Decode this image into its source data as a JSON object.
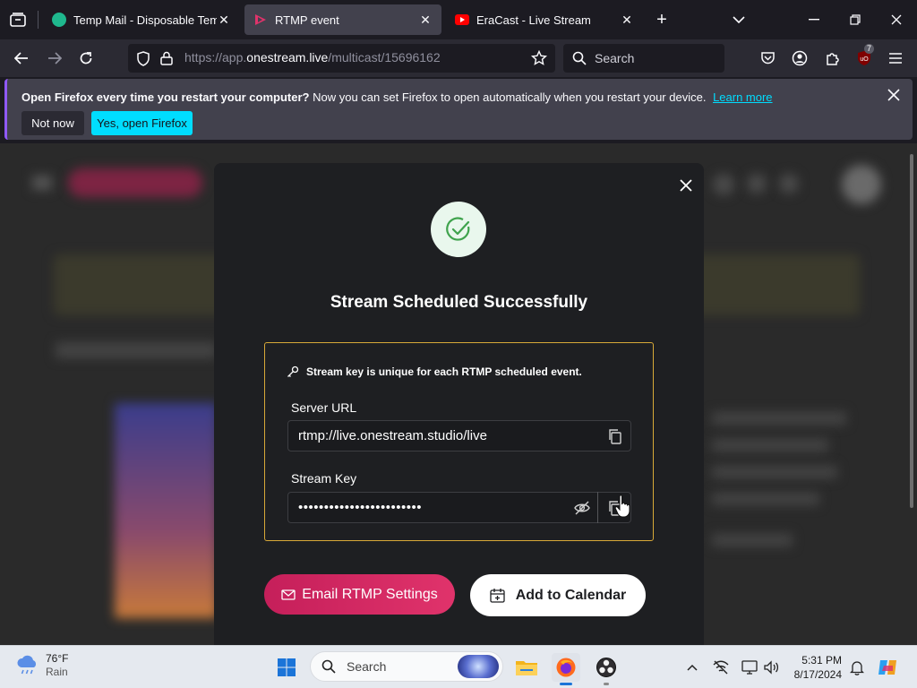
{
  "tabs": [
    {
      "title": "Temp Mail - Disposable Tempo",
      "active": false
    },
    {
      "title": "RTMP event",
      "active": true
    },
    {
      "title": "EraCast - Live Stream",
      "active": false
    }
  ],
  "nav": {
    "url_prefix": "https://app.",
    "url_domain": "onestream.live",
    "url_path": "/multicast/15696162",
    "search_placeholder": "Search",
    "extension_badge": "7"
  },
  "notification": {
    "bold": "Open Firefox every time you restart your computer?",
    "text": "Now you can set Firefox to open automatically when you restart your device.",
    "link": "Learn more",
    "not_now": "Not now",
    "yes": "Yes, open Firefox"
  },
  "modal": {
    "title": "Stream Scheduled Successfully",
    "key_note": "Stream key is unique for each RTMP scheduled event.",
    "server_url_label": "Server URL",
    "server_url_value": "rtmp://live.onestream.studio/live",
    "stream_key_label": "Stream Key",
    "stream_key_value": "••••••••••••••••••••••••",
    "email_button": "Email RTMP Settings",
    "calendar_button": "Add to Calendar"
  },
  "taskbar": {
    "temp": "76°F",
    "weather": "Rain",
    "search_placeholder": "Search",
    "time": "5:31 PM",
    "date": "8/17/2024"
  },
  "colors": {
    "accent_pink": "#d6265f",
    "key_border": "#d8a938",
    "success_green": "#3fa34d",
    "firefox_cyan": "#00ddff"
  }
}
